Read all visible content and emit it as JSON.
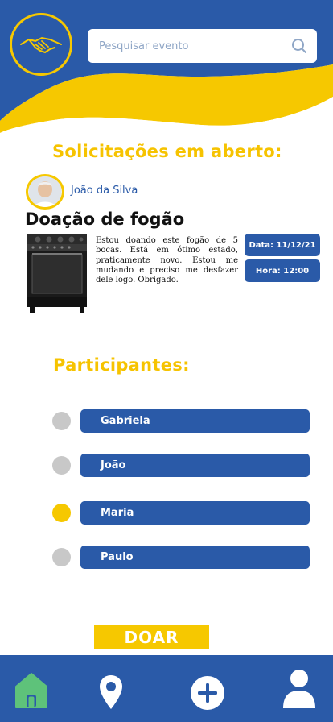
{
  "colors": {
    "brand_blue": "#2a5aa8",
    "accent_yellow": "#f6c800",
    "home_green": "#5ec27a",
    "inactive_gray": "#c8c8c8"
  },
  "search": {
    "placeholder": "Pesquisar evento",
    "icon": "search-icon"
  },
  "sections": {
    "open_requests": "Solicitações em aberto:",
    "participants": "Participantes:"
  },
  "request": {
    "user_name": "João da Silva",
    "title": "Doação de fogão",
    "description": "Estou doando este fogão de 5 bocas. Está em ótimo estado, praticamente novo. Estou me mudando e preciso me desfazer dele logo. Obrigado.",
    "date": "Data: 11/12/21",
    "time": "Hora: 12:00"
  },
  "participants": [
    {
      "name": "Gabriela",
      "selected": false
    },
    {
      "name": "João",
      "selected": false
    },
    {
      "name": "Maria",
      "selected": true
    },
    {
      "name": "Paulo",
      "selected": false
    }
  ],
  "donate_label": "DOAR",
  "nav": [
    "home-icon",
    "location-pin-icon",
    "add-icon",
    "profile-icon"
  ]
}
